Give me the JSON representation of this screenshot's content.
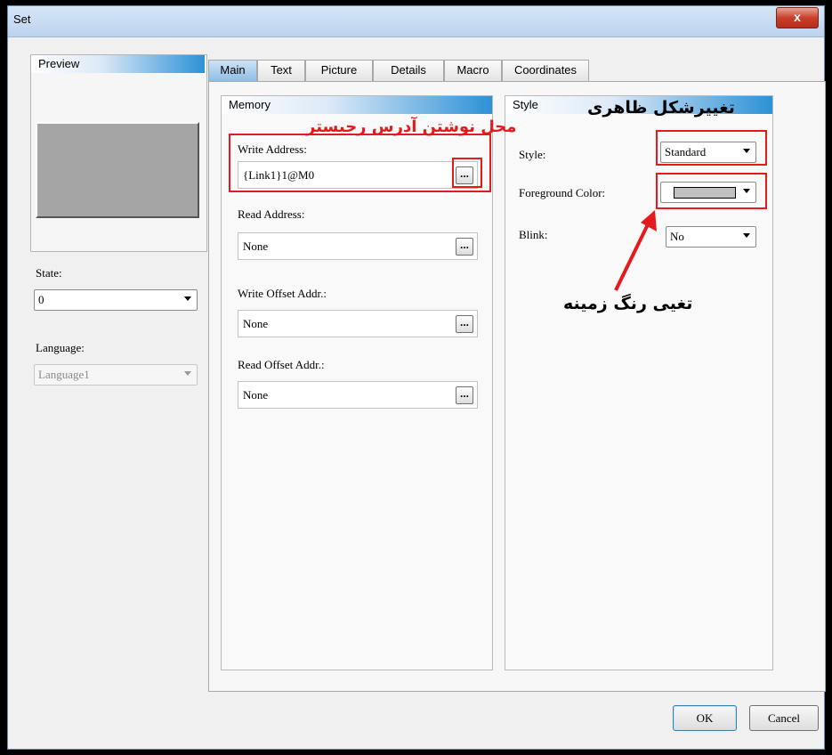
{
  "window": {
    "title": "Set",
    "close_label": "x"
  },
  "preview": {
    "header": "Preview"
  },
  "state": {
    "label": "State:",
    "value": "0"
  },
  "language": {
    "label": "Language:",
    "value": "Language1"
  },
  "tabs": [
    {
      "label": "Main",
      "active": true
    },
    {
      "label": "Text"
    },
    {
      "label": "Picture"
    },
    {
      "label": "Details"
    },
    {
      "label": "Macro"
    },
    {
      "label": "Coordinates"
    }
  ],
  "memory": {
    "header": "Memory",
    "write_address_label": "Write Address:",
    "write_address_value": "{Link1}1@M0",
    "read_address_label": "Read Address:",
    "read_address_value": "None",
    "write_offset_label": "Write Offset Addr.:",
    "write_offset_value": "None",
    "read_offset_label": "Read Offset Addr.:",
    "read_offset_value": "None",
    "browse_label": "..."
  },
  "style": {
    "header": "Style",
    "style_label": "Style:",
    "style_value": "Standard",
    "foreground_label": "Foreground Color:",
    "foreground_color": "#c0c0c0",
    "blink_label": "Blink:",
    "blink_value": "No"
  },
  "annotations": {
    "register_address": "محل نوشتن آدرس رجیستر",
    "appearance": "تغییرشکل ظاهری",
    "background_color": "تغیی رنگ زمینه",
    "color": "#e41b1b"
  },
  "buttons": {
    "ok": "OK",
    "cancel": "Cancel"
  }
}
